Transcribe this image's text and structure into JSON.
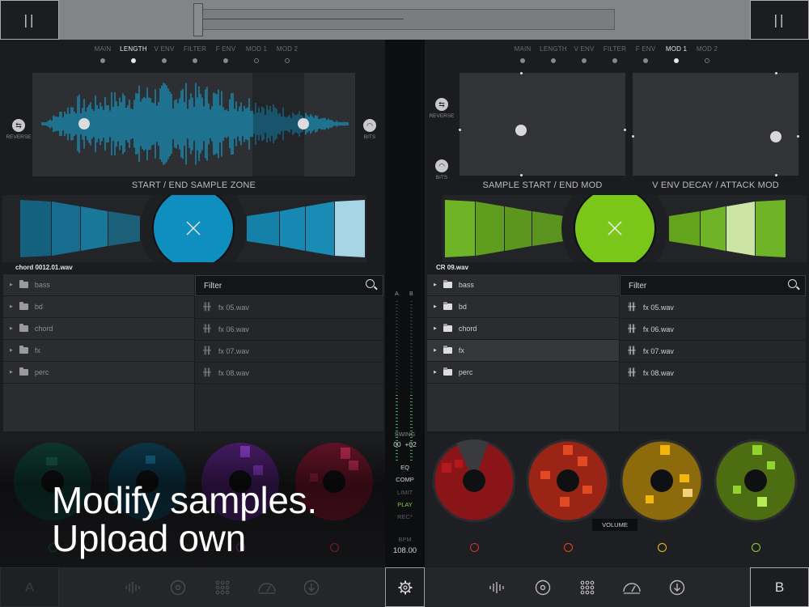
{
  "topbar": {
    "pause_left": "||",
    "pause_right": "||"
  },
  "deck_a": {
    "tabs": [
      {
        "label": "MAIN",
        "state": "filled"
      },
      {
        "label": "LENGTH",
        "state": "active"
      },
      {
        "label": "V ENV",
        "state": "filled"
      },
      {
        "label": "FILTER",
        "state": "filled"
      },
      {
        "label": "F ENV",
        "state": "filled"
      },
      {
        "label": "MOD 1",
        "state": "empty"
      },
      {
        "label": "MOD 2",
        "state": "empty"
      }
    ],
    "reverse_label": "REVERSE",
    "bits_label": "BITS",
    "zone_label": "START / END SAMPLE ZONE",
    "filename": "chord 0012.01.wav",
    "folders": [
      "bass",
      "bd",
      "chord",
      "fx",
      "perc"
    ],
    "filter_placeholder": "Filter",
    "files": [
      "fx 05.wav",
      "fx 06.wav",
      "fx 07.wav",
      "fx 08.wav"
    ],
    "accent": "#0e8fbf"
  },
  "deck_b": {
    "tabs": [
      {
        "label": "MAIN",
        "state": "filled"
      },
      {
        "label": "LENGTH",
        "state": "filled"
      },
      {
        "label": "V ENV",
        "state": "filled"
      },
      {
        "label": "FILTER",
        "state": "filled"
      },
      {
        "label": "F ENV",
        "state": "filled"
      },
      {
        "label": "MOD 1",
        "state": "active"
      },
      {
        "label": "MOD 2",
        "state": "empty"
      }
    ],
    "reverse_label": "REVERSE",
    "bits_label": "BITS",
    "xy1_label": "SAMPLE START / END MOD",
    "xy2_label": "V ENV DECAY / ATTACK MOD",
    "filename": "CR 09.wav",
    "folders": [
      "bass",
      "bd",
      "chord",
      "fx",
      "perc"
    ],
    "filter_placeholder": "Filter",
    "files": [
      "fx 05.wav",
      "fx 06.wav",
      "fx 07.wav",
      "fx 08.wav"
    ],
    "volume_label": "VOLUME",
    "accent": "#7ac71a"
  },
  "center": {
    "meter_a": "A",
    "meter_b": "B",
    "swing_label": "SWING",
    "swing_a": "00",
    "swing_b": "+02",
    "eq": "EQ",
    "comp": "COMP",
    "limit": "LIMIT",
    "play": "PLAY",
    "rec": "REC*",
    "bpm_label": "BPM",
    "bpm_value": "108.00"
  },
  "bottombar": {
    "deck_a": "A",
    "deck_b": "B",
    "settings_icon": "gear-icon"
  },
  "overlay": {
    "line1": "Modify samples.",
    "line2": "Upload own"
  },
  "colors": {
    "blue": "#0e8fbf",
    "green": "#7ac71a",
    "red": "#b3181c",
    "orange_red": "#c2361b",
    "amber": "#b8880c",
    "lime": "#6f9a1a",
    "purple": "#7d2fb3",
    "crimson": "#9e1c3d"
  }
}
